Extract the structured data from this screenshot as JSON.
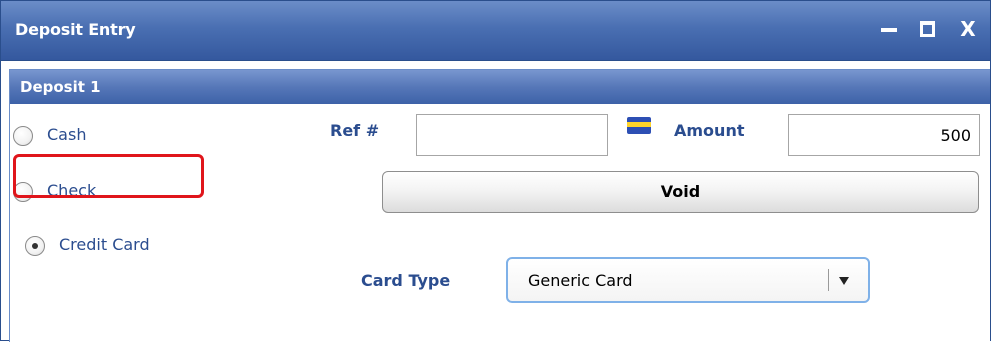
{
  "window": {
    "title": "Deposit Entry",
    "controls": {
      "minimize_icon": "minimize-icon",
      "maximize_icon": "maximize-icon",
      "close_label": "X"
    }
  },
  "panel": {
    "title": "Deposit 1"
  },
  "payment_methods": [
    {
      "label": "Cash",
      "selected": false
    },
    {
      "label": "Check",
      "selected": false
    },
    {
      "label": "Credit Card",
      "selected": true
    }
  ],
  "fields": {
    "ref_label": "Ref #",
    "ref_value": "",
    "amount_label": "Amount",
    "amount_value": "500",
    "void_label": "Void",
    "card_type_label": "Card Type",
    "card_type_value": "Generic Card"
  },
  "colors": {
    "title_bar": "#4a6fb2",
    "label_text": "#2b4d8f",
    "highlight": "#e0151b",
    "select_border": "#7fb1e8"
  },
  "icons": {
    "card": "credit-card-icon",
    "dropdown": "chevron-down-icon"
  }
}
